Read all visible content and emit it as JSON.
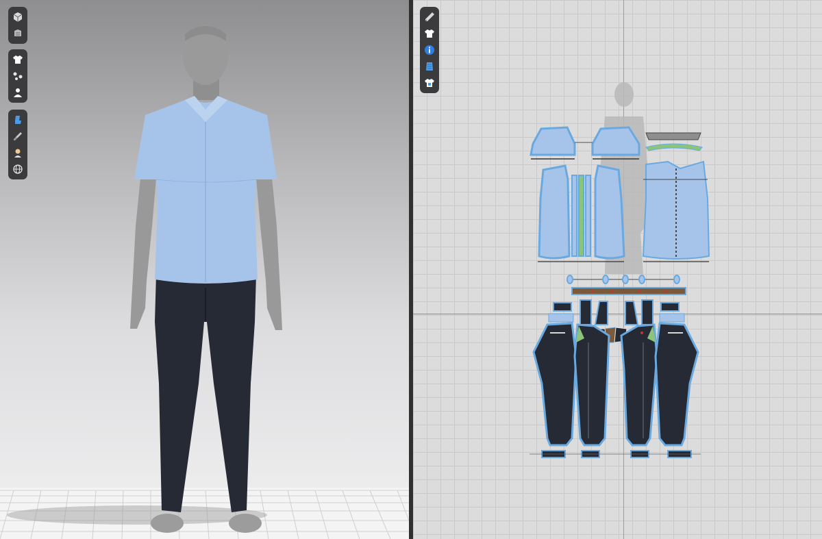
{
  "app": {
    "views": [
      "3d-garment-view",
      "2d-pattern-view"
    ]
  },
  "toolbar3d": {
    "groups": [
      [
        "cube-icon",
        "garment-stack-icon"
      ],
      [
        "shirt-icon",
        "points-icon",
        "avatar-icon"
      ],
      [
        "chair-icon",
        "brush-icon",
        "person-light-icon",
        "globe-icon"
      ]
    ]
  },
  "toolbar2d": {
    "items": [
      "pencil-icon",
      "shirt-icon",
      "info-icon",
      "fabric-icon",
      "pattern-shirt-icon"
    ]
  },
  "colors": {
    "shirt": "#a6c4ea",
    "shirt_outline": "#5d8ecf",
    "pants": "#262a35",
    "avatar": "#9a9a9a",
    "toolbar_bg": "#3b3b3d",
    "grid_bg": "#dcdcdc",
    "selection": "#6aa9e0",
    "seam_green": "#7cc36b",
    "waistband": "#7a5a3a"
  }
}
